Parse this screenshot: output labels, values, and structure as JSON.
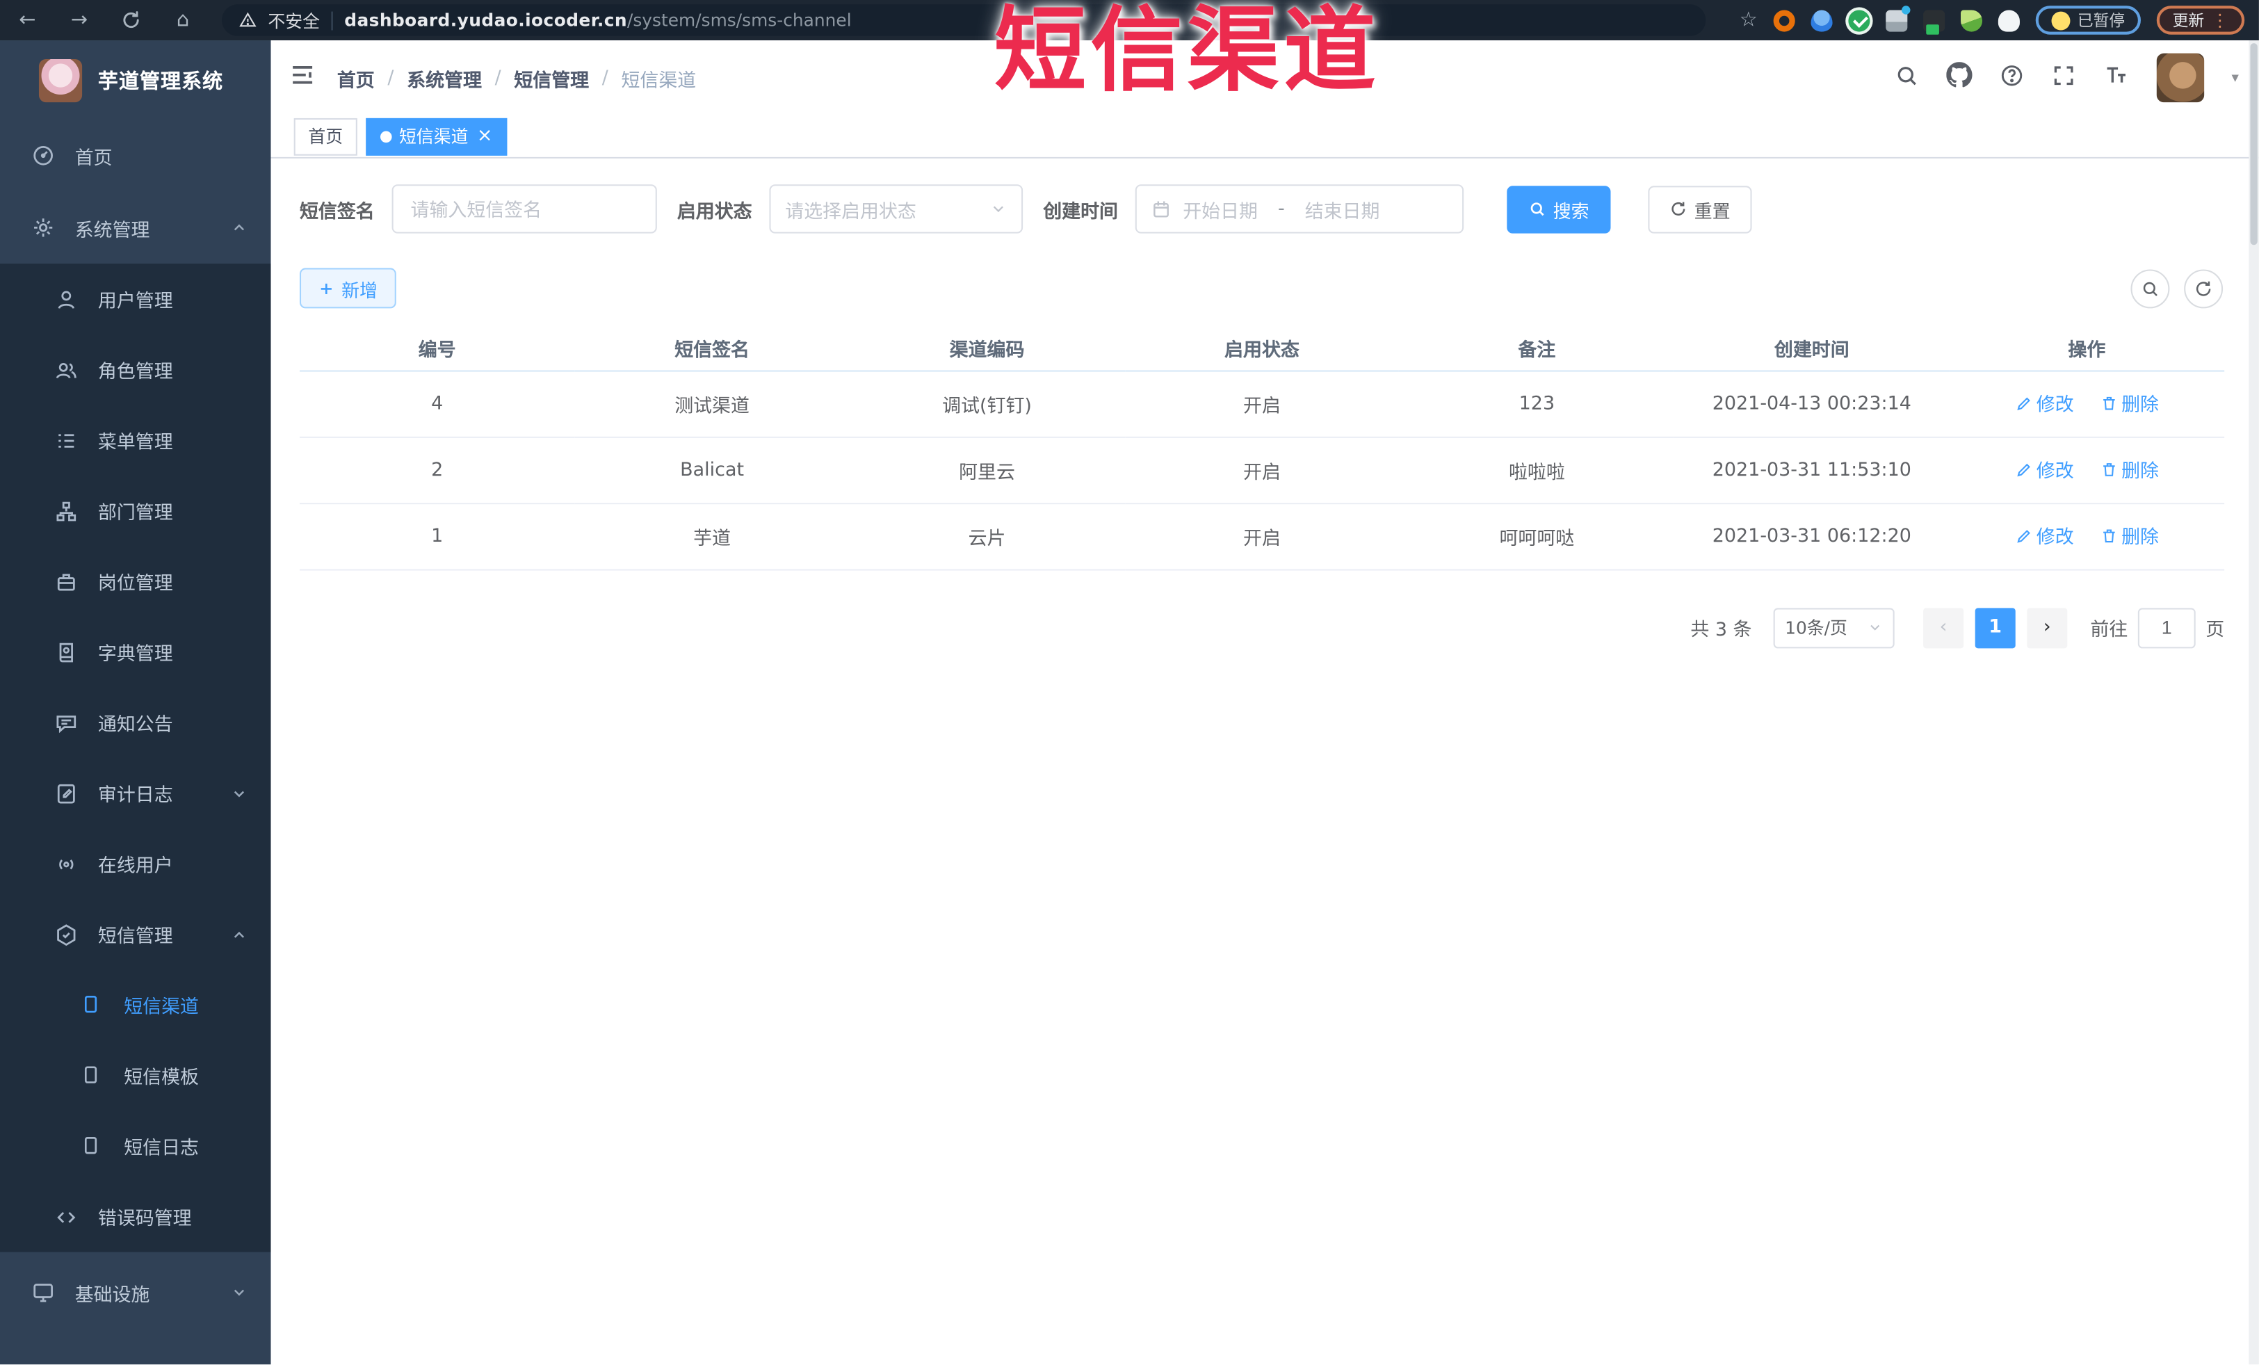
{
  "icons": {
    "back": "←",
    "forward": "→",
    "home_glyph": "⌂",
    "star": "☆",
    "close": "×",
    "dot": "●",
    "sep": "/",
    "caret_down": "▾",
    "prev": "‹",
    "next": "›",
    "kebab": "⋮"
  },
  "browser": {
    "security_label": "不安全",
    "url_domain": "dashboard.yudao.iocoder.cn",
    "url_path": "/system/sms/sms-channel",
    "paused_badge": "已暂停",
    "update_button": "更新"
  },
  "annotation": {
    "text": "短信渠道",
    "color": "#ec2b4e"
  },
  "sidebar": {
    "logo_title": "芋道管理系统",
    "items": [
      {
        "label": "首页"
      },
      {
        "label": "系统管理"
      },
      {
        "label": "用户管理"
      },
      {
        "label": "角色管理"
      },
      {
        "label": "菜单管理"
      },
      {
        "label": "部门管理"
      },
      {
        "label": "岗位管理"
      },
      {
        "label": "字典管理"
      },
      {
        "label": "通知公告"
      },
      {
        "label": "审计日志"
      },
      {
        "label": "在线用户"
      },
      {
        "label": "短信管理"
      },
      {
        "label": "短信渠道"
      },
      {
        "label": "短信模板"
      },
      {
        "label": "短信日志"
      },
      {
        "label": "错误码管理"
      },
      {
        "label": "基础设施"
      }
    ]
  },
  "navbar": {
    "breadcrumb": [
      "首页",
      "系统管理",
      "短信管理",
      "短信渠道"
    ]
  },
  "tabs": [
    {
      "label": "首页",
      "active": false
    },
    {
      "label": "短信渠道",
      "active": true
    }
  ],
  "filters": {
    "signature_label": "短信签名",
    "signature_placeholder": "请输入短信签名",
    "status_label": "启用状态",
    "status_placeholder": "请选择启用状态",
    "time_label": "创建时间",
    "date_start_placeholder": "开始日期",
    "date_separator": "-",
    "date_end_placeholder": "结束日期",
    "search_label": "搜索",
    "reset_label": "重置"
  },
  "toolbar": {
    "add_label": "新增"
  },
  "table": {
    "columns": [
      "编号",
      "短信签名",
      "渠道编码",
      "启用状态",
      "备注",
      "创建时间",
      "操作"
    ],
    "edit_label": "修改",
    "delete_label": "删除",
    "rows": [
      {
        "id": "4",
        "signature": "测试渠道",
        "code": "调试(钉钉)",
        "status": "开启",
        "remark": "123",
        "created": "2021-04-13 00:23:14"
      },
      {
        "id": "2",
        "signature": "Balicat",
        "code": "阿里云",
        "status": "开启",
        "remark": "啦啦啦",
        "created": "2021-03-31 11:53:10"
      },
      {
        "id": "1",
        "signature": "芋道",
        "code": "云片",
        "status": "开启",
        "remark": "呵呵呵哒",
        "created": "2021-03-31 06:12:20"
      }
    ]
  },
  "pagination": {
    "total_text": "共 3 条",
    "page_size": "10条/页",
    "current_page": "1",
    "goto_label": "前往",
    "goto_value": "1",
    "page_unit": "页"
  }
}
